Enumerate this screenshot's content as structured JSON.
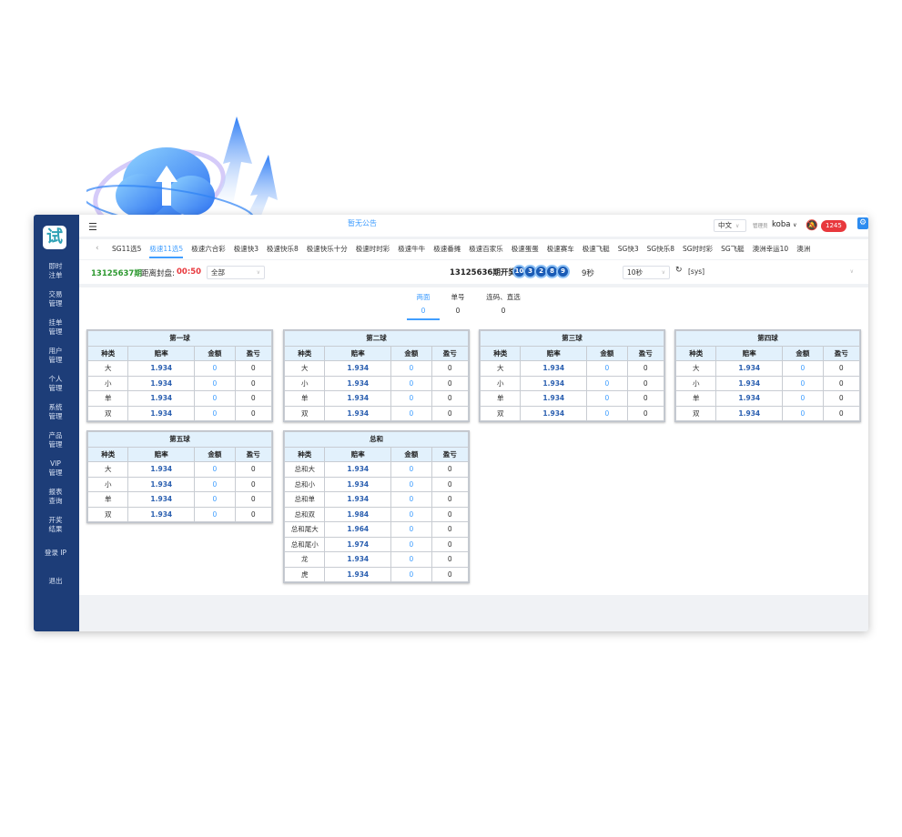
{
  "topbar": {
    "notice": "暂无公告",
    "language": "中文",
    "role": "管理员",
    "username": "koba",
    "badge_count": "1245"
  },
  "sidebar": {
    "logo": "试",
    "items": [
      "即时\n注单",
      "交易\n管理",
      "挂单\n管理",
      "用户\n管理",
      "个人\n管理",
      "系统\n管理",
      "产品\n管理",
      "VIP\n管理",
      "报表\n查询",
      "开奖\n结果",
      "登录 IP",
      "退出"
    ]
  },
  "tabs": {
    "items": [
      "SG11选5",
      "极速11选5",
      "极速六合彩",
      "极速快3",
      "极速快乐8",
      "极速快乐十分",
      "极速时时彩",
      "极速牛牛",
      "极速番摊",
      "极速百家乐",
      "极速蛋蛋",
      "极速赛车",
      "极速飞艇",
      "SG快3",
      "SG快乐8",
      "SG时时彩",
      "SG飞艇",
      "澳洲幸运10",
      "澳洲"
    ],
    "active_index": 1
  },
  "info": {
    "period": "13125637期",
    "close_label": "距离封盘:",
    "close_time": "00:50",
    "filter_value": "全部",
    "draw_period": "13125636期开奖",
    "balls": [
      "10",
      "3",
      "2",
      "8",
      "9"
    ],
    "countdown": "9秒",
    "interval_value": "10秒",
    "account_value": "[sys]"
  },
  "play_tabs": [
    {
      "label": "两面",
      "count": "0"
    },
    {
      "label": "单号",
      "count": "0"
    },
    {
      "label": "连码、直选",
      "count": "0"
    }
  ],
  "headers": [
    "种类",
    "赔率",
    "金额",
    "盈亏"
  ],
  "tables": [
    {
      "title": "第一球",
      "rows": [
        [
          "大",
          "1.934",
          "0",
          "0"
        ],
        [
          "小",
          "1.934",
          "0",
          "0"
        ],
        [
          "单",
          "1.934",
          "0",
          "0"
        ],
        [
          "双",
          "1.934",
          "0",
          "0"
        ]
      ]
    },
    {
      "title": "第二球",
      "rows": [
        [
          "大",
          "1.934",
          "0",
          "0"
        ],
        [
          "小",
          "1.934",
          "0",
          "0"
        ],
        [
          "单",
          "1.934",
          "0",
          "0"
        ],
        [
          "双",
          "1.934",
          "0",
          "0"
        ]
      ]
    },
    {
      "title": "第三球",
      "rows": [
        [
          "大",
          "1.934",
          "0",
          "0"
        ],
        [
          "小",
          "1.934",
          "0",
          "0"
        ],
        [
          "单",
          "1.934",
          "0",
          "0"
        ],
        [
          "双",
          "1.934",
          "0",
          "0"
        ]
      ]
    },
    {
      "title": "第四球",
      "rows": [
        [
          "大",
          "1.934",
          "0",
          "0"
        ],
        [
          "小",
          "1.934",
          "0",
          "0"
        ],
        [
          "单",
          "1.934",
          "0",
          "0"
        ],
        [
          "双",
          "1.934",
          "0",
          "0"
        ]
      ]
    },
    {
      "title": "第五球",
      "rows": [
        [
          "大",
          "1.934",
          "0",
          "0"
        ],
        [
          "小",
          "1.934",
          "0",
          "0"
        ],
        [
          "单",
          "1.934",
          "0",
          "0"
        ],
        [
          "双",
          "1.934",
          "0",
          "0"
        ]
      ]
    },
    {
      "title": "总和",
      "rows": [
        [
          "总和大",
          "1.934",
          "0",
          "0"
        ],
        [
          "总和小",
          "1.934",
          "0",
          "0"
        ],
        [
          "总和单",
          "1.934",
          "0",
          "0"
        ],
        [
          "总和双",
          "1.984",
          "0",
          "0"
        ],
        [
          "总和尾大",
          "1.964",
          "0",
          "0"
        ],
        [
          "总和尾小",
          "1.974",
          "0",
          "0"
        ],
        [
          "龙",
          "1.934",
          "0",
          "0"
        ],
        [
          "虎",
          "1.934",
          "0",
          "0"
        ]
      ]
    }
  ]
}
